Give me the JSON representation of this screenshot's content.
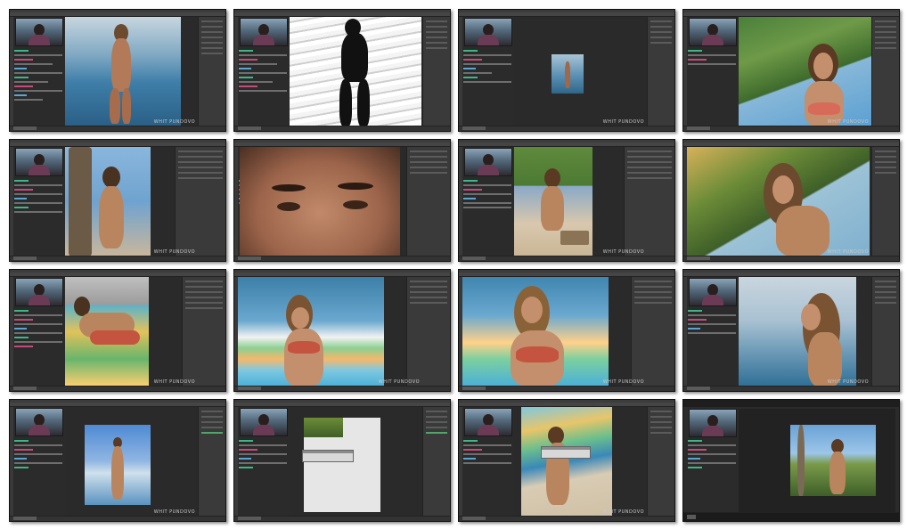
{
  "sheet": {
    "columns": 4,
    "rows": 4,
    "tile_count": 16
  },
  "overlay": {
    "logo_text": "WHIT PUNDOVO"
  },
  "colors": {
    "app_background": "#2b2b2b",
    "panel": "#3a3a3a",
    "chat_green": "#3fb58a",
    "chat_pink": "#c44b7a",
    "chat_blue": "#5aa6d6"
  },
  "tiles": [
    {
      "scene": "beach-standing"
    },
    {
      "scene": "silhouette-mask"
    },
    {
      "scene": "small-thumb"
    },
    {
      "scene": "palm-portrait"
    },
    {
      "scene": "tree-bikini"
    },
    {
      "scene": "eyes-closeup"
    },
    {
      "scene": "beach-chair"
    },
    {
      "scene": "palm-closeup"
    },
    {
      "scene": "surfboards-lying"
    },
    {
      "scene": "arms-up-wide"
    },
    {
      "scene": "arms-up-close"
    },
    {
      "scene": "profile-sunset"
    },
    {
      "scene": "standing-sky"
    },
    {
      "scene": "blank-dialog"
    },
    {
      "scene": "surfboard-dialog"
    },
    {
      "scene": "video-player"
    }
  ]
}
